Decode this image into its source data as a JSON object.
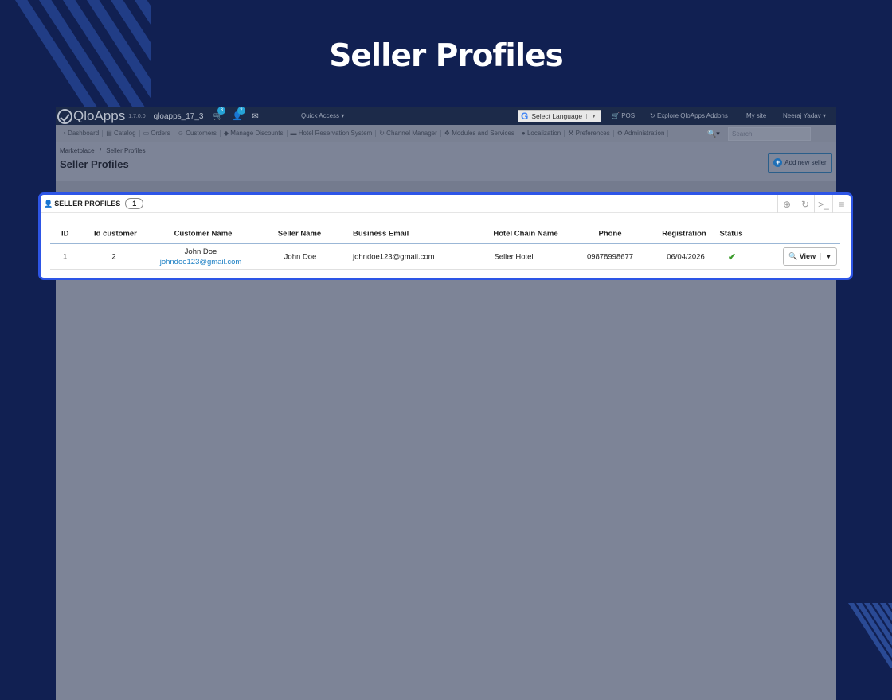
{
  "page_title": "Seller Profiles",
  "topbar": {
    "brand": "QloApps",
    "version": "1.7.0.0",
    "shop_name": "qloapps_17_3",
    "cart_badge": "3",
    "customer_badge": "2",
    "quick_access": "Quick Access",
    "language": "Select Language",
    "pos": "POS",
    "addons": "Explore QloApps Addons",
    "my_site": "My site",
    "user": "Neeraj Yadav"
  },
  "nav": {
    "items": [
      "Dashboard",
      "Catalog",
      "Orders",
      "Customers",
      "Manage Discounts",
      "Hotel Reservation System",
      "Channel Manager",
      "Modules and Services",
      "Localization",
      "Preferences",
      "Administration"
    ],
    "search_placeholder": "Search"
  },
  "breadcrumb": {
    "parent": "Marketplace",
    "sep": "/",
    "current": "Seller Profiles"
  },
  "heading": "Seller Profiles",
  "add_button": "Add new seller",
  "panel": {
    "title": "SELLER PROFILES",
    "count": "1",
    "columns": [
      "ID",
      "Id customer",
      "Customer Name",
      "Seller Name",
      "Business Email",
      "Hotel Chain Name",
      "Phone",
      "Registration",
      "Status"
    ],
    "rows": [
      {
        "id": "1",
        "id_customer": "2",
        "customer_name": "John Doe",
        "customer_email": "johndoe123@gmail.com",
        "seller_name": "John Doe",
        "business_email": "johndoe123@gmail.com",
        "hotel_chain": "Seller Hotel",
        "phone": "09878998677",
        "registration": "06/04/2026",
        "status": "active",
        "action": "View"
      }
    ]
  }
}
